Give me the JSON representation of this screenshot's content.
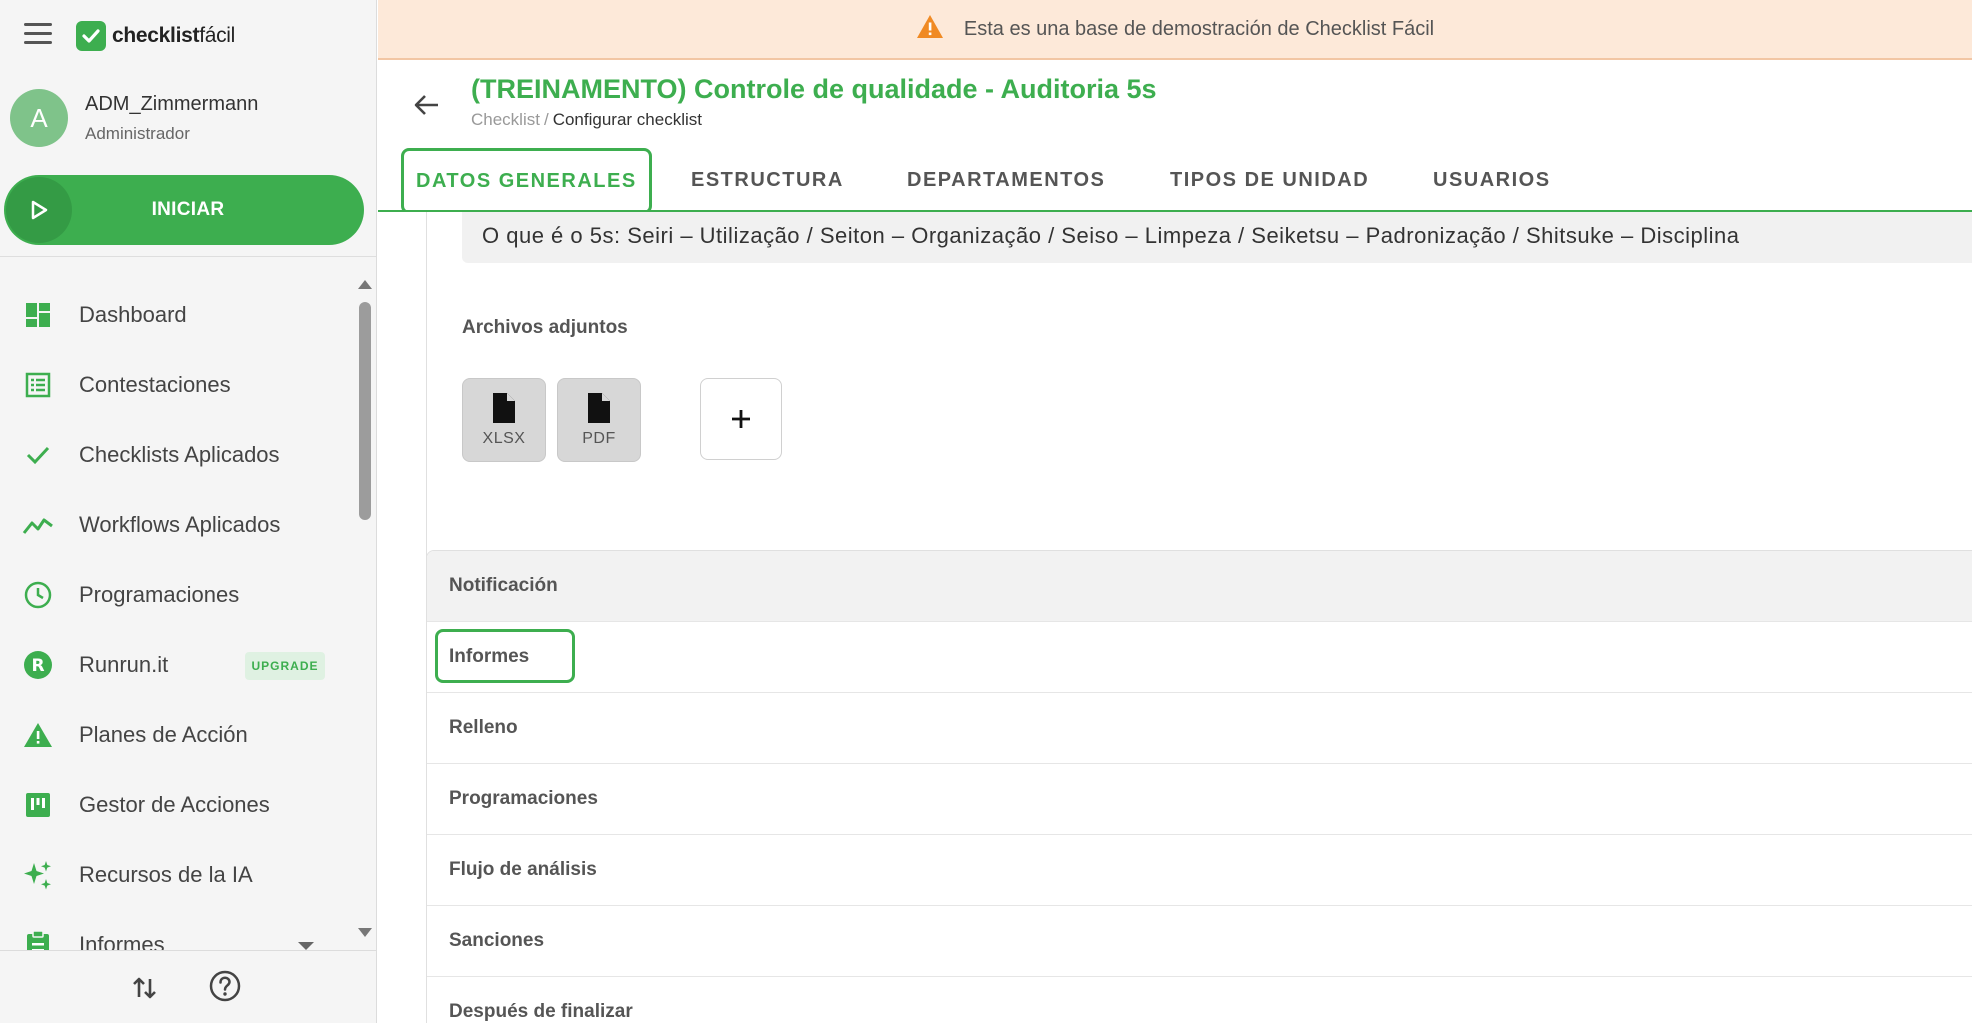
{
  "app": {
    "brand_name_bold": "checklist",
    "brand_name_light": "fácil"
  },
  "user": {
    "initial": "A",
    "name": "ADM_Zimmermann",
    "role": "Administrador"
  },
  "start_button": {
    "label": "INICIAR"
  },
  "menu": {
    "items": [
      {
        "label": "Dashboard",
        "icon": "dashboard-icon"
      },
      {
        "label": "Contestaciones",
        "icon": "list-icon"
      },
      {
        "label": "Checklists Aplicados",
        "icon": "check-icon"
      },
      {
        "label": "Workflows Aplicados",
        "icon": "trending-icon"
      },
      {
        "label": "Programaciones",
        "icon": "clock-icon"
      },
      {
        "label": "Runrun.it",
        "icon": "runrunit-icon",
        "badge": "UPGRADE"
      },
      {
        "label": "Planes de Acción",
        "icon": "warning-icon"
      },
      {
        "label": "Gestor de Acciones",
        "icon": "kanban-icon"
      },
      {
        "label": "Recursos de la IA",
        "icon": "sparkles-icon"
      },
      {
        "label": "Informes",
        "icon": "clipboard-icon"
      }
    ]
  },
  "banner": {
    "text": "Esta es una base de demostración de Checklist Fácil"
  },
  "page": {
    "title": "(TREINAMENTO) Controle de qualidade - Auditoria 5s",
    "breadcrumb_parent": "Checklist",
    "breadcrumb_separator": "/",
    "breadcrumb_current": "Configurar checklist"
  },
  "tabs": [
    {
      "label": "DATOS GENERALES",
      "active": true
    },
    {
      "label": "ESTRUCTURA"
    },
    {
      "label": "DEPARTAMENTOS"
    },
    {
      "label": "TIPOS DE UNIDAD"
    },
    {
      "label": "USUARIOS"
    }
  ],
  "general": {
    "description": "O que é o 5s:  Seiri – Utilização / Seiton – Organização / Seiso – Limpeza / Seiketsu – Padronização / Shitsuke – Disciplina",
    "attachments_title": "Archivos adjuntos",
    "attachments": [
      {
        "label": "XLSX",
        "icon": "file-icon"
      },
      {
        "label": "PDF",
        "icon": "file-icon"
      }
    ],
    "add_label": "+"
  },
  "settings_sections": [
    "Notificación",
    "Informes",
    "Relleno",
    "Programaciones",
    "Flujo de análisis",
    "Sanciones",
    "Después de finalizar"
  ],
  "colors": {
    "brand_green": "#3dae4f",
    "banner_bg": "#fde9d9",
    "warning_orange": "#f08a24"
  }
}
